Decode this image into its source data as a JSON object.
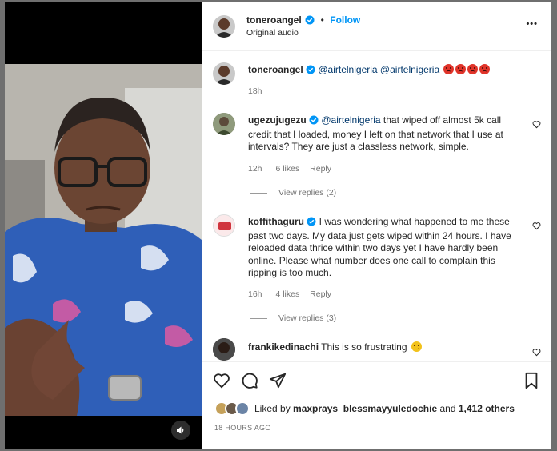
{
  "header": {
    "username": "toneroangel",
    "dot": "•",
    "follow_label": "Follow",
    "audio_label": "Original audio",
    "more_label": "•••"
  },
  "caption": {
    "username": "toneroangel",
    "mention1": "@airtelnigeria",
    "mention2": "@airtelnigeria",
    "time": "18h"
  },
  "comments": [
    {
      "username": "ugezujugezu",
      "mention": "@airtelnigeria",
      "text_line1": " that wiped off almost 5k call",
      "text_line2": "credit that I loaded, money I left on that network that I use at",
      "text_line3": "intervals? They are just a classless network, simple.",
      "time": "12h",
      "likes": "6 likes",
      "reply": "Reply",
      "view_replies": "View replies (2)"
    },
    {
      "username": "koffithaguru",
      "text_line1": " I was wondering what happened to me these",
      "text_line2": "past two days. My data just gets wiped within 24 hours. I have",
      "text_line3": "reloaded data thrice within two days yet I have hardly been",
      "text_line4": "online. Please what number does one call to complain this",
      "text_line5": "ripping is too much.",
      "time": "16h",
      "likes": "4 likes",
      "reply": "Reply",
      "view_replies": "View replies (3)"
    },
    {
      "username": "frankikedinachi",
      "text": " This is so frustrating"
    }
  ],
  "likes": {
    "prefix": "Liked by ",
    "user": "maxprays_blessmayyuledochie",
    "and": " and ",
    "others": "1,412 others"
  },
  "timestamp": "18 HOURS AGO",
  "colors": {
    "follow": "#0095f6",
    "verified": "#0095f6",
    "mention": "#00376b",
    "meta": "#737373"
  },
  "icons": [
    "heart-icon",
    "comment-icon",
    "share-icon",
    "bookmark-icon",
    "more-icon",
    "mute-icon",
    "verified-icon"
  ]
}
